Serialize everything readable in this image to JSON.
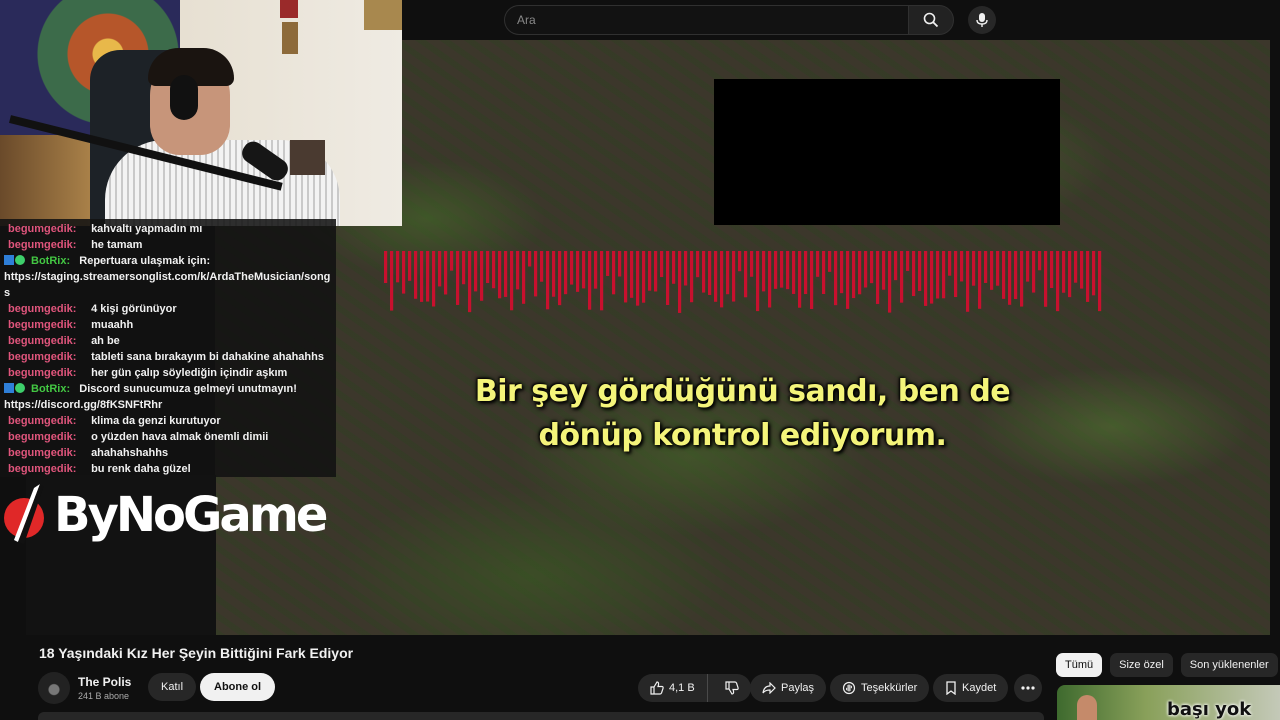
{
  "search": {
    "placeholder": "Ara"
  },
  "video": {
    "subtitle_line1": "Bir şey gördüğünü sandı, ben de",
    "subtitle_line2": "dönüp kontrol ediyorum."
  },
  "chat": {
    "partial_user": "begumgedik:",
    "partial_msg": "kahvaltı yapmadın mı",
    "lines": [
      {
        "user": "begumgedik:",
        "msg": "he tamam"
      },
      {
        "bot": "BotRix:",
        "msg": "Repertuara ulaşmak için:",
        "link": "https://staging.streamersonglist.com/k/ArdaTheMusician/songs"
      },
      {
        "user": "begumgedik:",
        "msg": "4 kişi görünüyor"
      },
      {
        "user": "begumgedik:",
        "msg": "muaahh"
      },
      {
        "user": "begumgedik:",
        "msg": "ah be"
      },
      {
        "user": "begumgedik:",
        "msg": "tableti sana bırakayım bi dahakine ahahahhs"
      },
      {
        "user": "begumgedik:",
        "msg": "her gün çalıp söylediğin içindir aşkım"
      },
      {
        "bot": "BotRix:",
        "msg": "Discord sunucumuza gelmeyi unutmayın!",
        "link": "https://discord.gg/8fKSNFtRhr"
      },
      {
        "user": "begumgedik:",
        "msg": "klima da genzi kurutuyor"
      },
      {
        "user": "begumgedik:",
        "msg": "o yüzden hava almak önemli dimii"
      },
      {
        "user": "begumgedik:",
        "msg": "ahahahshahhs"
      },
      {
        "user": "begumgedik:",
        "msg": "bu renk daha güzel"
      }
    ]
  },
  "overlay_logo": {
    "text": "ByNoGame"
  },
  "details": {
    "title": "18 Yaşındaki Kız Her Şeyin Bittiğini Fark Ediyor",
    "channel_name": "The Polis",
    "subscribers": "241 B abone",
    "join_label": "Katıl",
    "subscribe_label": "Abone ol",
    "like_count": "4,1 B",
    "share_label": "Paylaş",
    "thanks_label": "Teşekkürler",
    "save_label": "Kaydet"
  },
  "sidebar": {
    "chips": [
      "Tümü",
      "Size özel",
      "Son yüklenenler"
    ],
    "thumb_text": "başı yok"
  },
  "colors": {
    "chat_user": "#e0557c",
    "bot_name": "#43c743",
    "subtitle": "#f4f47a",
    "wave": "#c8102e"
  }
}
